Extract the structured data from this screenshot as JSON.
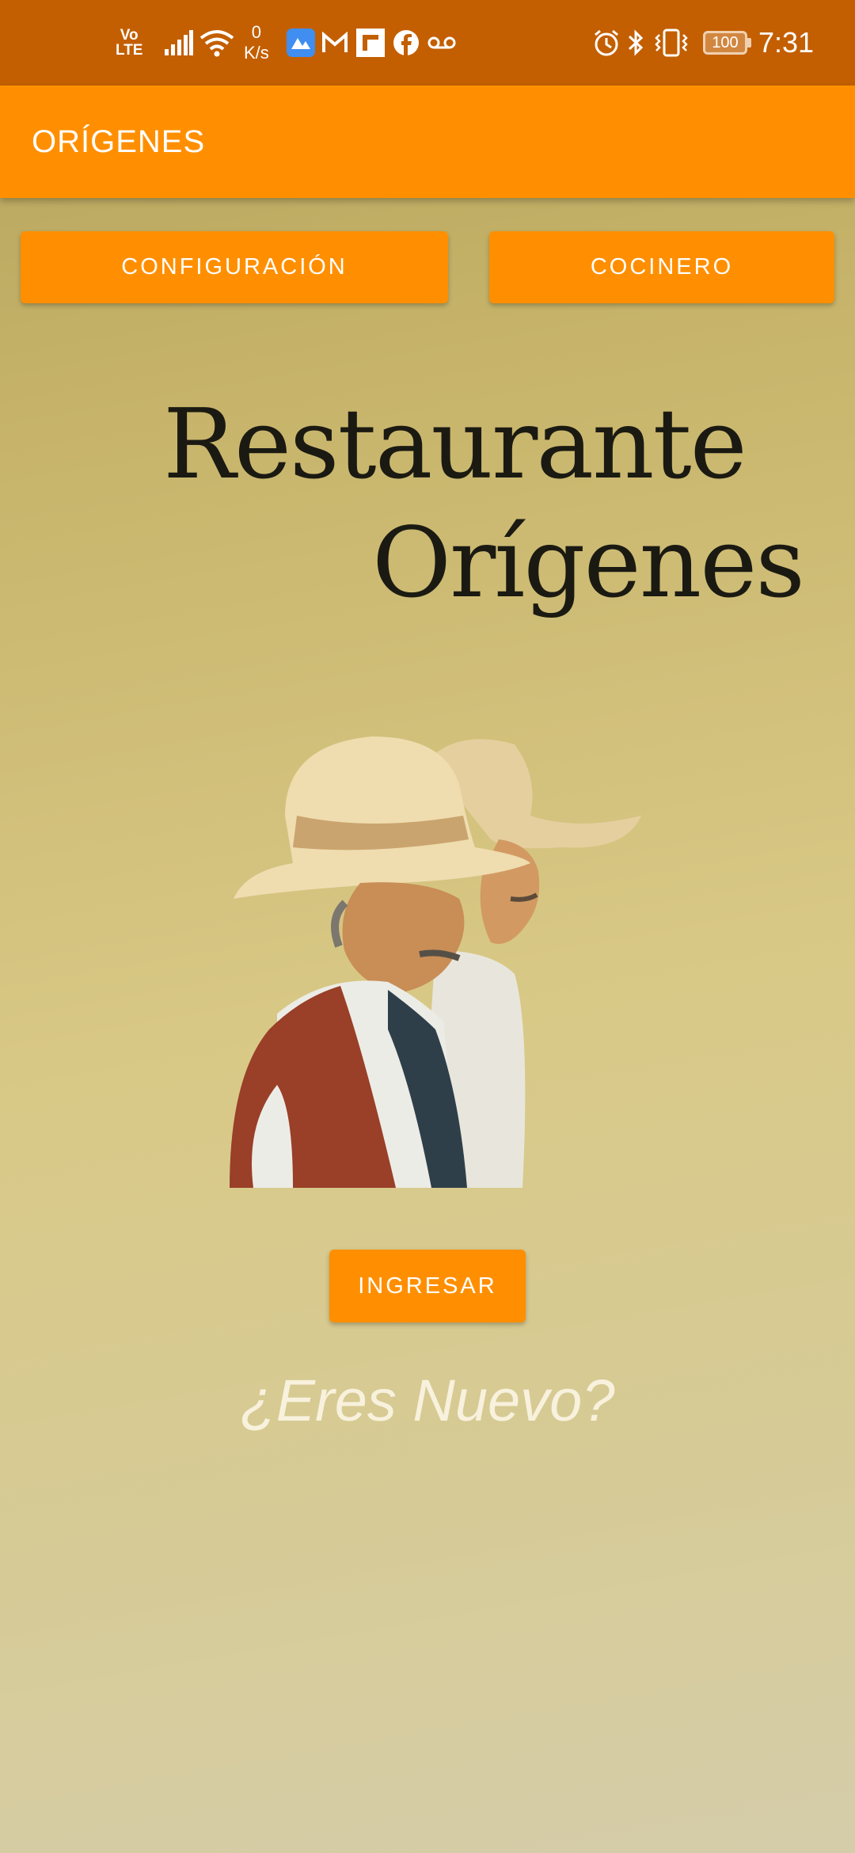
{
  "status_bar": {
    "network_label_top": "Vo",
    "network_label_bottom": "LTE",
    "speed_value": "0",
    "speed_unit": "K/s",
    "battery": "100",
    "time": "7:31",
    "icons": [
      "signal-icon",
      "wifi-icon",
      "app-notification-icon",
      "gmail-icon",
      "news-icon",
      "facebook-icon",
      "voicemail-icon",
      "alarm-icon",
      "bluetooth-icon",
      "vibrate-icon",
      "battery-icon"
    ]
  },
  "app_bar": {
    "title": "ORÍGENES"
  },
  "buttons": {
    "config_label": "CONFIGURACIÓN",
    "cook_label": "COCINERO",
    "login_label": "INGRESAR"
  },
  "logo": {
    "line1": "Restaurante",
    "line2": "Orígenes"
  },
  "new_user_prompt": "¿Eres Nuevo?",
  "colors": {
    "status_bar": "#c35f00",
    "accent": "#ff8f00",
    "background_top": "#b4a25c",
    "background_bottom": "#d5cdaa"
  }
}
